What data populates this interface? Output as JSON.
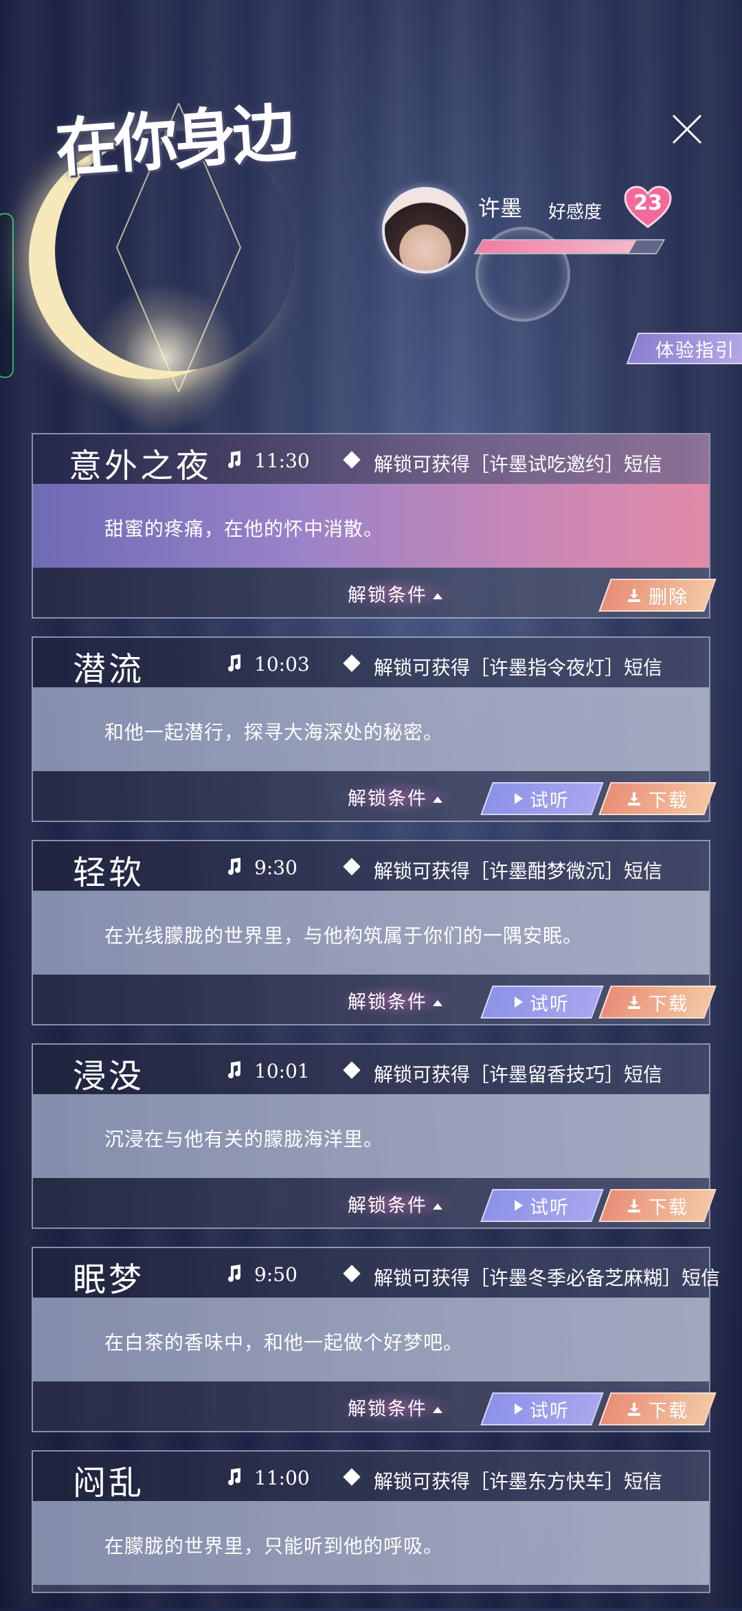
{
  "logo": {
    "text": "在你身边"
  },
  "character": {
    "name": "许墨",
    "affinity_label": "好感度",
    "affinity_value": "23",
    "affinity_fill": 0.85
  },
  "guide_button": "体验指引",
  "cond_label": "解锁条件",
  "play_label": "试听",
  "download_label": "下载",
  "delete_label": "删除",
  "songs": [
    {
      "title": "意外之夜",
      "duration": "11:30",
      "reward": "解锁可获得［许墨试吃邀约］短信",
      "desc": "甜蜜的疼痛，在他的怀中消散。"
    },
    {
      "title": "潜流",
      "duration": "10:03",
      "reward": "解锁可获得［许墨指令夜灯］短信",
      "desc": "和他一起潜行，探寻大海深处的秘密。"
    },
    {
      "title": "轻软",
      "duration": "9:30",
      "reward": "解锁可获得［许墨酣梦微沉］短信",
      "desc": "在光线朦胧的世界里，与他构筑属于你们的一隅安眠。"
    },
    {
      "title": "浸没",
      "duration": "10:01",
      "reward": "解锁可获得［许墨留香技巧］短信",
      "desc": "沉浸在与他有关的朦胧海洋里。"
    },
    {
      "title": "眠梦",
      "duration": "9:50",
      "reward": "解锁可获得［许墨冬季必备芝麻糊］短信",
      "desc": "在白茶的香味中，和他一起做个好梦吧。"
    },
    {
      "title": "闷乱",
      "duration": "11:00",
      "reward": "解锁可获得［许墨东方快车］短信",
      "desc": "在朦胧的世界里，只能听到他的呼吸。"
    }
  ]
}
